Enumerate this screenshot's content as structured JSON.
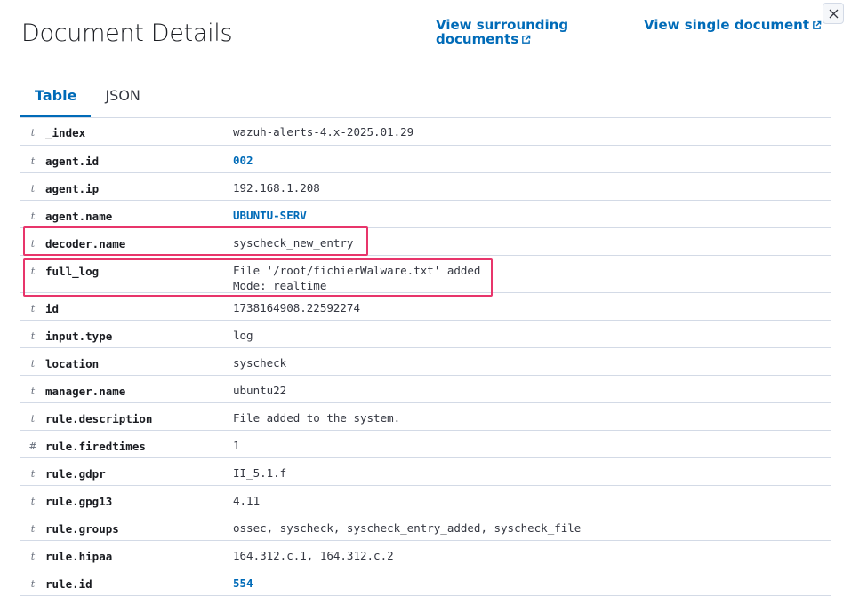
{
  "header": {
    "title": "Document Details",
    "view_surrounding": "View surrounding documents",
    "view_single": "View single document"
  },
  "tabs": [
    {
      "label": "Table",
      "active": true
    },
    {
      "label": "JSON",
      "active": false
    }
  ],
  "rows": [
    {
      "type": "t",
      "field": "_index",
      "value": "wazuh-alerts-4.x-2025.01.29",
      "link": false
    },
    {
      "type": "t",
      "field": "agent.id",
      "value": "002",
      "link": true
    },
    {
      "type": "t",
      "field": "agent.ip",
      "value": "192.168.1.208",
      "link": false
    },
    {
      "type": "t",
      "field": "agent.name",
      "value": "UBUNTU-SERV",
      "link": true
    },
    {
      "type": "t",
      "field": "decoder.name",
      "value": "syscheck_new_entry",
      "link": false,
      "highlighted": true
    },
    {
      "type": "t",
      "field": "full_log",
      "value": "File '/root/fichierWalware.txt' added\nMode: realtime",
      "link": false,
      "highlighted": true
    },
    {
      "type": "t",
      "field": "id",
      "value": "1738164908.22592274",
      "link": false
    },
    {
      "type": "t",
      "field": "input.type",
      "value": "log",
      "link": false
    },
    {
      "type": "t",
      "field": "location",
      "value": "syscheck",
      "link": false
    },
    {
      "type": "t",
      "field": "manager.name",
      "value": "ubuntu22",
      "link": false
    },
    {
      "type": "t",
      "field": "rule.description",
      "value": "File added to the system.",
      "link": false
    },
    {
      "type": "#",
      "field": "rule.firedtimes",
      "value": "1",
      "link": false
    },
    {
      "type": "t",
      "field": "rule.gdpr",
      "value": "II_5.1.f",
      "link": false
    },
    {
      "type": "t",
      "field": "rule.gpg13",
      "value": "4.11",
      "link": false
    },
    {
      "type": "t",
      "field": "rule.groups",
      "value": "ossec, syscheck, syscheck_entry_added, syscheck_file",
      "link": false
    },
    {
      "type": "t",
      "field": "rule.hipaa",
      "value": "164.312.c.1, 164.312.c.2",
      "link": false
    },
    {
      "type": "t",
      "field": "rule.id",
      "value": "554",
      "link": true
    }
  ],
  "colors": {
    "accent": "#006bb8",
    "highlight": "#e8356b",
    "border": "#d3dae6"
  },
  "icons": {
    "external": "external-link-icon",
    "close": "close-icon"
  }
}
